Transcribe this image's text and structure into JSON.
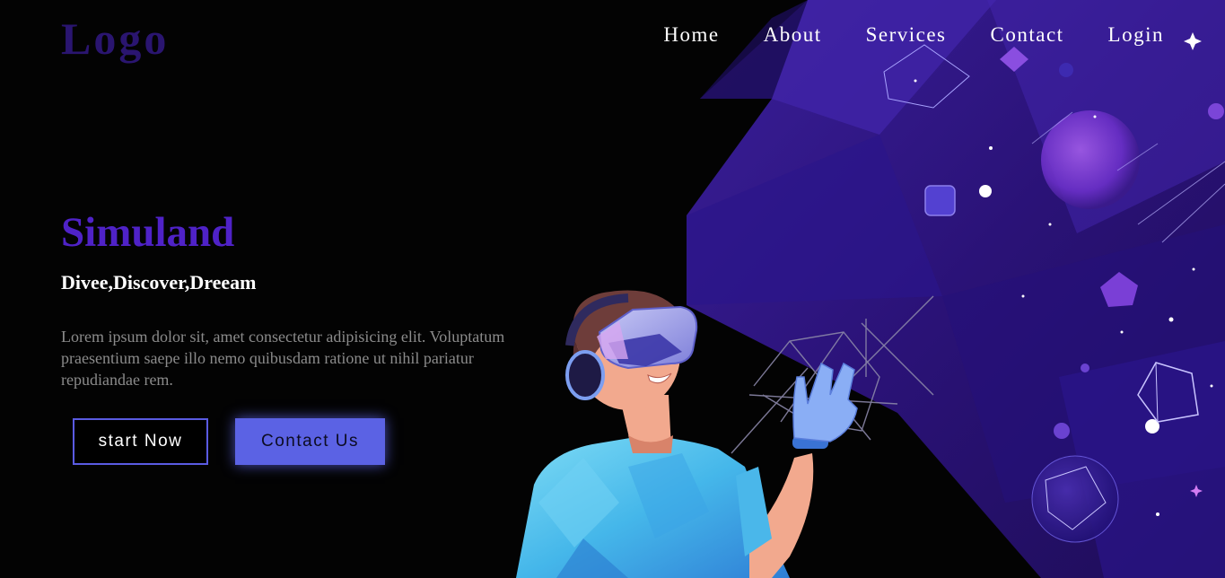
{
  "header": {
    "logo": "Logo",
    "nav": [
      {
        "label": "Home"
      },
      {
        "label": "About"
      },
      {
        "label": "Services"
      },
      {
        "label": "Contact"
      },
      {
        "label": "Login"
      }
    ]
  },
  "hero": {
    "title": "Simuland",
    "subtitle": "Divee,Discover,Dreeam",
    "description": "Lorem ipsum dolor sit, amet consectetur adipisicing elit. Voluptatum praesentium saepe illo nemo quibusdam ratione ut nihil pariatur repudiandae rem.",
    "primary_button": "start Now",
    "secondary_button": "Contact Us",
    "illustration": "vr-headset-person-illustration"
  },
  "colors": {
    "background": "#030303",
    "logo": "#2a1570",
    "title": "#4f22c7",
    "accent_button": "#5b62e4",
    "nav_text": "#ffffff",
    "description_text": "#8b8b8b"
  }
}
